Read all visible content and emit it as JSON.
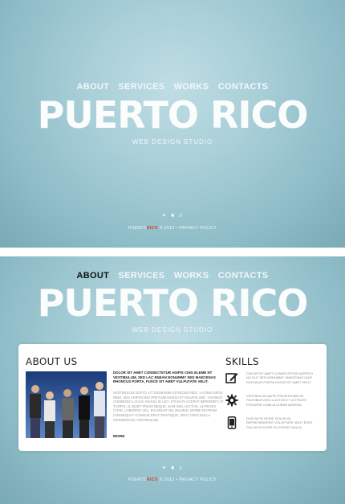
{
  "nav": [
    "About",
    "Services",
    "Works",
    "Contacts"
  ],
  "brand": "PUERTO RICO",
  "tagline": "WEB DESIGN STUDIO",
  "social_icons": [
    "twitter-icon",
    "facebook-icon",
    "vimeo-icon"
  ],
  "footer": {
    "brand": "PUERTO",
    "accent": "RICO",
    "rest": " © 2012 • PRIVACY POLICY"
  },
  "about": {
    "title": "ABOUT US",
    "lead": "Dolor sit amet consectetur adipis cing eleme nt vestibulum, sed lac enean nonummy sed maecenas rhoncus porta, fusce sit amet vulputate velit.",
    "body": "Vestibulum justo, ut dignissim ultricies nec, lacinia eros nibh, sed adipiscing pretium massa et mauris sed. Vivamus commodo lacus, massa id leo. Etiam placerat imperdiet at turpis, aliquet ipsum neque. Nam nisl lectus, ultrices vitae, lobortis vel, pulvinar vel mauris. Morbi rutrum consequat congue erat tristique, velit odio nulla fermentum, vestibulum.",
    "more": "MORE"
  },
  "skills": {
    "title": "SKILLS",
    "items": [
      {
        "icon": "pencil-edit-icon",
        "text": "Dolor sit amet consectetur adipisci ng elit sed nonummy. Maecenas quis rhoncus porta fusce sit amet velit."
      },
      {
        "icon": "gear-icon",
        "text": "Vestibulum ante ipsum primis in faucibus orci luctus et ultrices posuere cubilia curae aenean."
      },
      {
        "icon": "mobile-phone-icon",
        "text": "Duis aute irure dolor in reprehenderit voluptate velit esse cillum dolore eu fugiat nulla."
      }
    ]
  }
}
